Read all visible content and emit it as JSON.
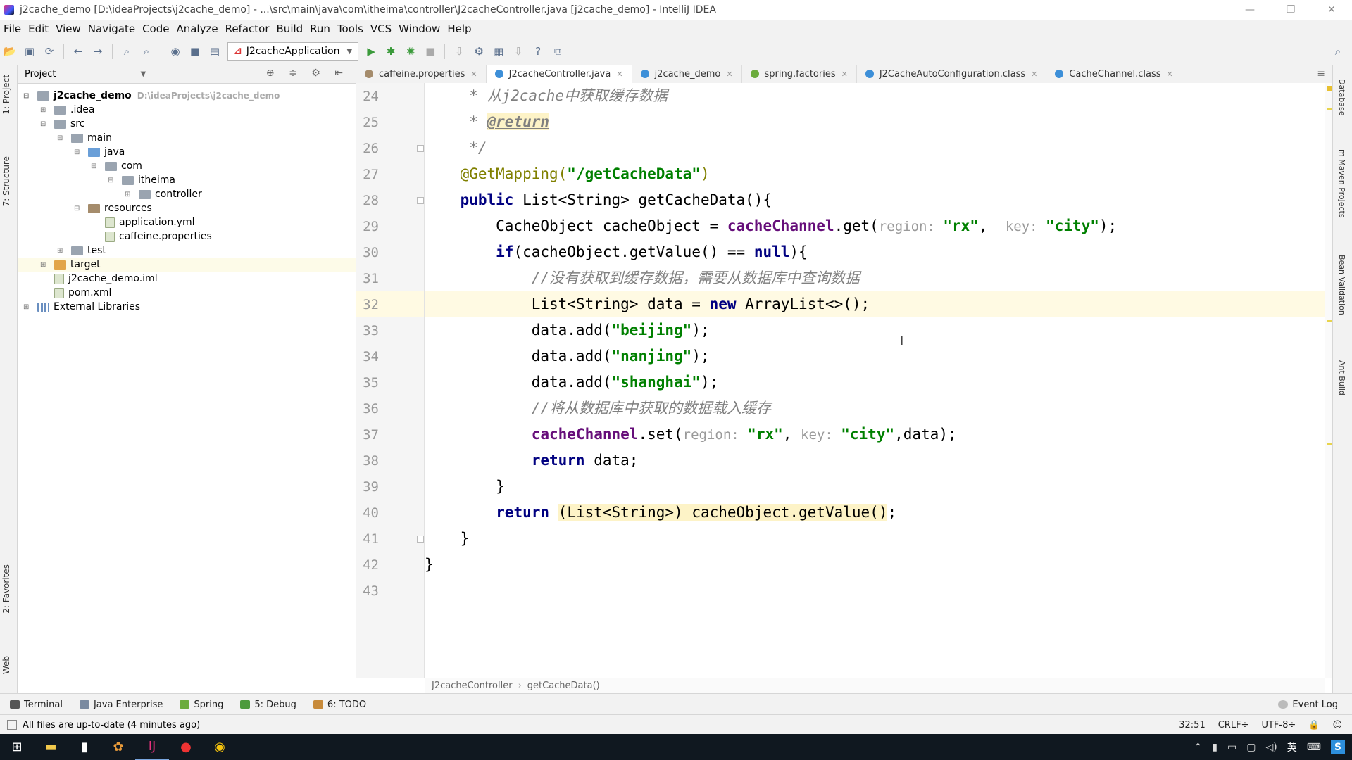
{
  "window": {
    "title": "j2cache_demo [D:\\ideaProjects\\j2cache_demo] - ...\\src\\main\\java\\com\\itheima\\controller\\J2cacheController.java [j2cache_demo] - IntelliJ IDEA",
    "min": "—",
    "max": "❐",
    "close": "✕"
  },
  "menu": [
    "File",
    "Edit",
    "View",
    "Navigate",
    "Code",
    "Analyze",
    "Refactor",
    "Build",
    "Run",
    "Tools",
    "VCS",
    "Window",
    "Help"
  ],
  "toolbar": {
    "run_config": "J2cacheApplication"
  },
  "left_strip": {
    "project": "1: Project",
    "structure": "7: Structure",
    "favorites": "2: Favorites",
    "web": "Web"
  },
  "project": {
    "header": "Project",
    "tree": [
      {
        "label": "j2cache_demo",
        "extra": "D:\\ideaProjects\\j2cache_demo",
        "depth": 0,
        "toggle": "⊟",
        "icon": "fold",
        "root": true
      },
      {
        "label": ".idea",
        "depth": 1,
        "toggle": "⊞",
        "icon": "fold"
      },
      {
        "label": "src",
        "depth": 1,
        "toggle": "⊟",
        "icon": "fold"
      },
      {
        "label": "main",
        "depth": 2,
        "toggle": "⊟",
        "icon": "fold"
      },
      {
        "label": "java",
        "depth": 3,
        "toggle": "⊟",
        "icon": "fold-blue"
      },
      {
        "label": "com",
        "depth": 4,
        "toggle": "⊟",
        "icon": "fold"
      },
      {
        "label": "itheima",
        "depth": 5,
        "toggle": "⊟",
        "icon": "fold"
      },
      {
        "label": "controller",
        "depth": 6,
        "toggle": "⊞",
        "icon": "fold"
      },
      {
        "label": "resources",
        "depth": 3,
        "toggle": "⊟",
        "icon": "fold-res"
      },
      {
        "label": "application.yml",
        "depth": 4,
        "toggle": "",
        "icon": "ic-file"
      },
      {
        "label": "caffeine.properties",
        "depth": 4,
        "toggle": "",
        "icon": "ic-file"
      },
      {
        "label": "test",
        "depth": 2,
        "toggle": "⊞",
        "icon": "fold"
      },
      {
        "label": "target",
        "depth": 1,
        "toggle": "⊞",
        "icon": "fold-orange"
      },
      {
        "label": "j2cache_demo.iml",
        "depth": 1,
        "toggle": "",
        "icon": "ic-file"
      },
      {
        "label": "pom.xml",
        "depth": 1,
        "toggle": "",
        "icon": "ic-file"
      },
      {
        "label": "External Libraries",
        "depth": 0,
        "toggle": "⊞",
        "icon": "ic-lib"
      }
    ]
  },
  "tabs": [
    {
      "label": "caffeine.properties",
      "color": "#a58c6c",
      "active": false
    },
    {
      "label": "J2cacheController.java",
      "color": "#3d8fd8",
      "active": true
    },
    {
      "label": "j2cache_demo",
      "color": "#3d8fd8",
      "active": false
    },
    {
      "label": "spring.factories",
      "color": "#6bab3c",
      "active": false
    },
    {
      "label": "J2CacheAutoConfiguration.class",
      "color": "#3d8fd8",
      "active": false
    },
    {
      "label": "CacheChannel.class",
      "color": "#3d8fd8",
      "active": false
    }
  ],
  "code": {
    "current_line": "32",
    "lines": [
      {
        "n": "24",
        "parts": [
          {
            "t": "     * 从j2cache中获取缓存数据",
            "c": "cmt"
          }
        ]
      },
      {
        "n": "25",
        "parts": [
          {
            "t": "     * ",
            "c": "cmt"
          },
          {
            "t": "@return",
            "c": "tag"
          }
        ]
      },
      {
        "n": "26",
        "parts": [
          {
            "t": "     */",
            "c": "cmt"
          }
        ]
      },
      {
        "n": "27",
        "parts": [
          {
            "t": "    @GetMapping(",
            "c": "ann"
          },
          {
            "t": "\"/getCacheData\"",
            "c": "str"
          },
          {
            "t": ")",
            "c": "ann"
          }
        ]
      },
      {
        "n": "28",
        "parts": [
          {
            "t": "    ",
            "c": ""
          },
          {
            "t": "public",
            "c": "kw"
          },
          {
            "t": " List<String> getCacheData(){",
            "c": ""
          }
        ]
      },
      {
        "n": "29",
        "parts": [
          {
            "t": "        CacheObject cacheObject = ",
            "c": ""
          },
          {
            "t": "cacheChannel",
            "c": "fld"
          },
          {
            "t": ".get(",
            "c": ""
          },
          {
            "t": "region: ",
            "c": "hint"
          },
          {
            "t": "\"rx\"",
            "c": "str"
          },
          {
            "t": ",  ",
            "c": ""
          },
          {
            "t": "key: ",
            "c": "hint"
          },
          {
            "t": "\"city\"",
            "c": "str"
          },
          {
            "t": ");",
            "c": ""
          }
        ]
      },
      {
        "n": "30",
        "parts": [
          {
            "t": "        ",
            "c": ""
          },
          {
            "t": "if",
            "c": "kw"
          },
          {
            "t": "(cacheObject.getValue() == ",
            "c": ""
          },
          {
            "t": "null",
            "c": "kw"
          },
          {
            "t": "){",
            "c": ""
          }
        ]
      },
      {
        "n": "31",
        "parts": [
          {
            "t": "            //没有获取到缓存数据，需要从数据库中查询数据",
            "c": "cmt"
          }
        ]
      },
      {
        "n": "32",
        "parts": [
          {
            "t": "            List<String> data = ",
            "c": ""
          },
          {
            "t": "new",
            "c": "kw"
          },
          {
            "t": " ArrayList<>();",
            "c": ""
          }
        ]
      },
      {
        "n": "33",
        "parts": [
          {
            "t": "            data.add(",
            "c": ""
          },
          {
            "t": "\"beijing\"",
            "c": "str"
          },
          {
            "t": ");",
            "c": ""
          }
        ]
      },
      {
        "n": "34",
        "parts": [
          {
            "t": "            data.add(",
            "c": ""
          },
          {
            "t": "\"nanjing\"",
            "c": "str"
          },
          {
            "t": ");",
            "c": ""
          }
        ]
      },
      {
        "n": "35",
        "parts": [
          {
            "t": "            data.add(",
            "c": ""
          },
          {
            "t": "\"shanghai\"",
            "c": "str"
          },
          {
            "t": ");",
            "c": ""
          }
        ]
      },
      {
        "n": "36",
        "parts": [
          {
            "t": "            //将从数据库中获取的数据载入缓存",
            "c": "cmt"
          }
        ]
      },
      {
        "n": "37",
        "parts": [
          {
            "t": "            ",
            "c": ""
          },
          {
            "t": "cacheChannel",
            "c": "fld"
          },
          {
            "t": ".set(",
            "c": ""
          },
          {
            "t": "region: ",
            "c": "hint"
          },
          {
            "t": "\"rx\"",
            "c": "str"
          },
          {
            "t": ", ",
            "c": ""
          },
          {
            "t": "key: ",
            "c": "hint"
          },
          {
            "t": "\"city\"",
            "c": "str"
          },
          {
            "t": ",data);",
            "c": ""
          }
        ]
      },
      {
        "n": "38",
        "parts": [
          {
            "t": "            ",
            "c": ""
          },
          {
            "t": "return",
            "c": "kw"
          },
          {
            "t": " data;",
            "c": ""
          }
        ]
      },
      {
        "n": "39",
        "parts": [
          {
            "t": "        }",
            "c": ""
          }
        ]
      },
      {
        "n": "40",
        "parts": [
          {
            "t": "        ",
            "c": ""
          },
          {
            "t": "return",
            "c": "kw"
          },
          {
            "t": " ",
            "c": ""
          },
          {
            "t": "(List<String>) cacheObject.getValue()",
            "c": "hl"
          },
          {
            "t": ";",
            "c": ""
          }
        ]
      },
      {
        "n": "41",
        "parts": [
          {
            "t": "    }",
            "c": ""
          }
        ]
      },
      {
        "n": "42",
        "parts": [
          {
            "t": "}",
            "c": ""
          }
        ]
      },
      {
        "n": "43",
        "parts": []
      }
    ]
  },
  "breadcrumb": {
    "class": "J2cacheController",
    "sep": "›",
    "method": "getCacheData()"
  },
  "right_bar": [
    "Database",
    "m Maven Projects",
    "Bean Validation",
    "Ant Build"
  ],
  "tool_windows": [
    {
      "label": "Terminal",
      "color": "#555"
    },
    {
      "label": "Java Enterprise",
      "color": "#7a8aa0"
    },
    {
      "label": "Spring",
      "color": "#6bab3c"
    },
    {
      "label": "5: Debug",
      "color": "#4c9a3c"
    },
    {
      "label": "6: TODO",
      "color": "#c78a3a"
    }
  ],
  "event_log": "Event Log",
  "status": {
    "message": "All files are up-to-date (4 minutes ago)",
    "position": "32:51",
    "line_sep": "CRLF÷",
    "encoding": "UTF-8÷"
  },
  "taskbar": {
    "lang": "英",
    "ime": "S"
  },
  "colors": {
    "keyword": "#000080",
    "string": "#008000",
    "comment": "#808080",
    "annotation": "#808000",
    "field": "#660e7a",
    "caretline": "#fffae3"
  }
}
